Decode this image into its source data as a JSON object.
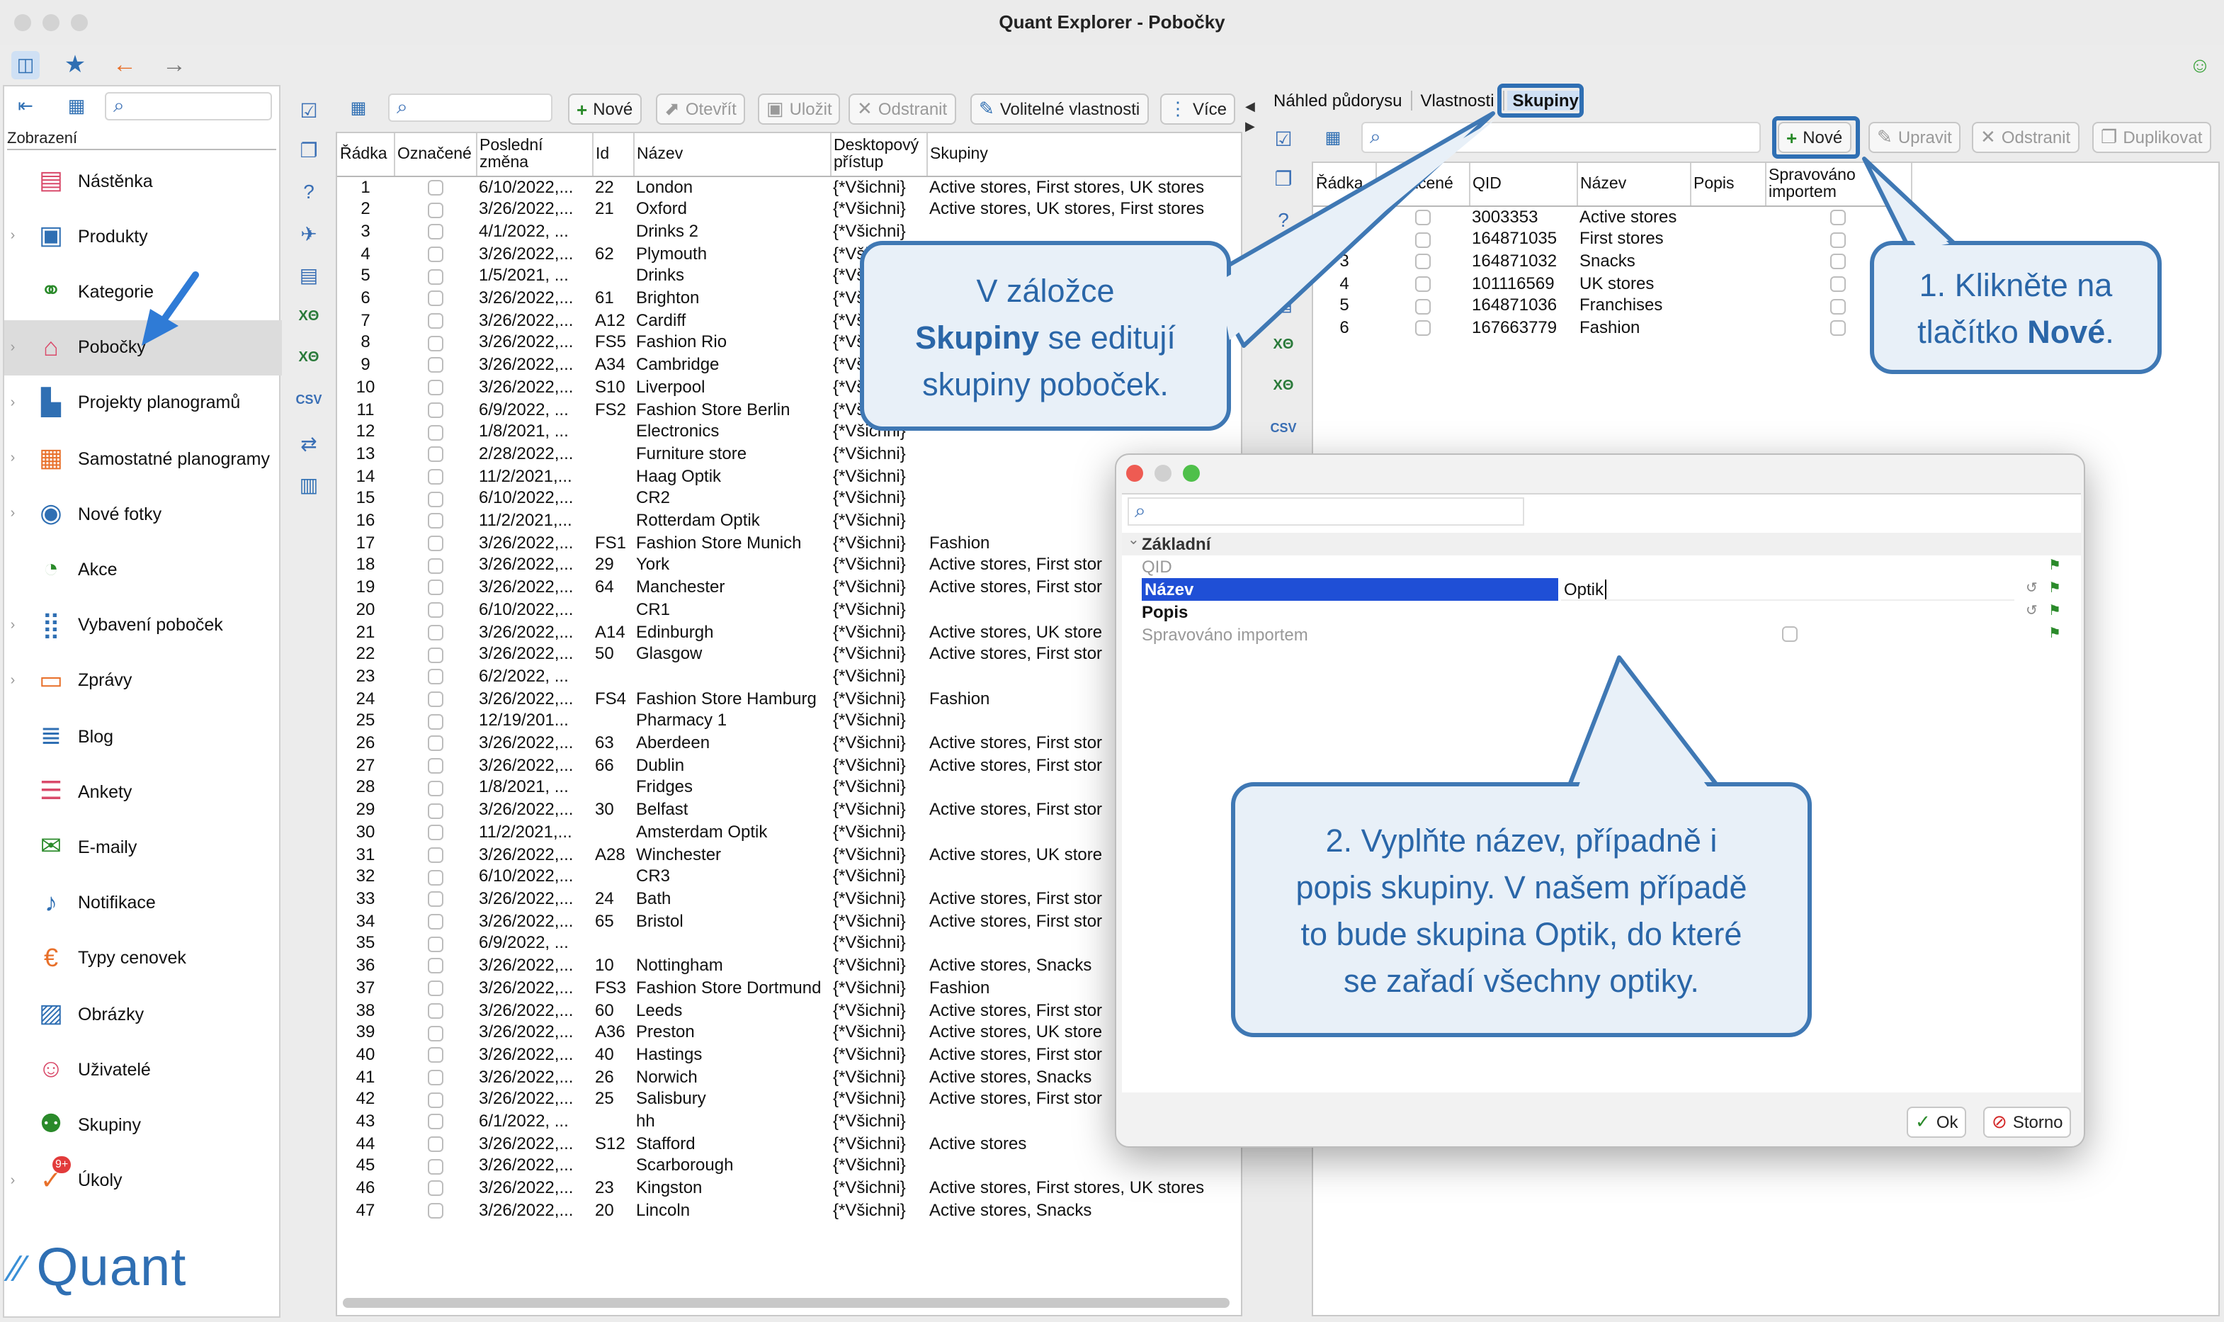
{
  "window": {
    "title": "Quant Explorer - Pobočky"
  },
  "sidebar": {
    "header": "Zobrazení",
    "items": [
      {
        "label": "Nástěnka",
        "icon": "dashboard-icon"
      },
      {
        "label": "Produkty",
        "icon": "product-icon"
      },
      {
        "label": "Kategorie",
        "icon": "category-icon"
      },
      {
        "label": "Pobočky",
        "icon": "store-icon",
        "selected": true
      },
      {
        "label": "Projekty planogramů",
        "icon": "planogram-project-icon"
      },
      {
        "label": "Samostatné planogramy",
        "icon": "planogram-icon"
      },
      {
        "label": "Nové fotky",
        "icon": "camera-icon"
      },
      {
        "label": "Akce",
        "icon": "promo-icon"
      },
      {
        "label": "Vybavení poboček",
        "icon": "equipment-icon"
      },
      {
        "label": "Zprávy",
        "icon": "message-icon"
      },
      {
        "label": "Blog",
        "icon": "blog-icon"
      },
      {
        "label": "Ankety",
        "icon": "survey-icon"
      },
      {
        "label": "E-maily",
        "icon": "email-icon"
      },
      {
        "label": "Notifikace",
        "icon": "bell-icon"
      },
      {
        "label": "Typy cenovek",
        "icon": "price-tag-icon"
      },
      {
        "label": "Obrázky",
        "icon": "image-icon"
      },
      {
        "label": "Uživatelé",
        "icon": "user-icon"
      },
      {
        "label": "Skupiny",
        "icon": "group-icon"
      },
      {
        "label": "Úkoly",
        "icon": "task-icon",
        "badge": "9+"
      }
    ],
    "logo": "Quant"
  },
  "stores": {
    "toolbar": {
      "new": "Nové",
      "open": "Otevřít",
      "save": "Uložit",
      "remove": "Odstranit",
      "props": "Volitelné vlastnosti",
      "more": "Více"
    },
    "columns": [
      "Řádka",
      "Označené",
      "Poslední změna",
      "Id",
      "Název",
      "Desktopový přístup",
      "Skupiny"
    ],
    "rows": [
      [
        "1",
        "6/10/2022,...",
        "22",
        "London",
        "{*Všichni}",
        "Active stores, First stores, UK stores"
      ],
      [
        "2",
        "3/26/2022,...",
        "21",
        "Oxford",
        "{*Všichni}",
        "Active stores, UK stores, First stores"
      ],
      [
        "3",
        "4/1/2022, ...",
        "",
        "Drinks 2",
        "{*Všichni}",
        ""
      ],
      [
        "4",
        "3/26/2022,...",
        "62",
        "Plymouth",
        "{*Všichni}",
        ""
      ],
      [
        "5",
        "1/5/2021, ...",
        "",
        "Drinks",
        "{*Všichni}",
        ""
      ],
      [
        "6",
        "3/26/2022,...",
        "61",
        "Brighton",
        "{*Všichni}",
        ""
      ],
      [
        "7",
        "3/26/2022,...",
        "A12",
        "Cardiff",
        "{*Všichni}",
        ""
      ],
      [
        "8",
        "3/26/2022,...",
        "FS5",
        "Fashion Rio",
        "{*Všichni}",
        ""
      ],
      [
        "9",
        "3/26/2022,...",
        "A34",
        "Cambridge",
        "{*Všichni}",
        ""
      ],
      [
        "10",
        "3/26/2022,...",
        "S10",
        "Liverpool",
        "{*Všichni}",
        ""
      ],
      [
        "11",
        "6/9/2022, ...",
        "FS2",
        "Fashion Store Berlin",
        "{*Všichni}",
        ""
      ],
      [
        "12",
        "1/8/2021, ...",
        "",
        "Electronics",
        "{*Všichni}",
        ""
      ],
      [
        "13",
        "2/28/2022,...",
        "",
        "Furniture store",
        "{*Všichni}",
        ""
      ],
      [
        "14",
        "11/2/2021,...",
        "",
        "Haag Optik",
        "{*Všichni}",
        ""
      ],
      [
        "15",
        "6/10/2022,...",
        "",
        "CR2",
        "{*Všichni}",
        ""
      ],
      [
        "16",
        "11/2/2021,...",
        "",
        "Rotterdam Optik",
        "{*Všichni}",
        ""
      ],
      [
        "17",
        "3/26/2022,...",
        "FS1",
        "Fashion Store Munich",
        "{*Všichni}",
        "Fashion"
      ],
      [
        "18",
        "3/26/2022,...",
        "29",
        "York",
        "{*Všichni}",
        "Active stores, First stor"
      ],
      [
        "19",
        "3/26/2022,...",
        "64",
        "Manchester",
        "{*Všichni}",
        "Active stores, First stor"
      ],
      [
        "20",
        "6/10/2022,...",
        "",
        "CR1",
        "{*Všichni}",
        ""
      ],
      [
        "21",
        "3/26/2022,...",
        "A14",
        "Edinburgh",
        "{*Všichni}",
        "Active stores, UK store"
      ],
      [
        "22",
        "3/26/2022,...",
        "50",
        "Glasgow",
        "{*Všichni}",
        "Active stores, First stor"
      ],
      [
        "23",
        "6/2/2022, ...",
        "",
        "",
        "{*Všichni}",
        ""
      ],
      [
        "24",
        "3/26/2022,...",
        "FS4",
        "Fashion Store Hamburg",
        "{*Všichni}",
        "Fashion"
      ],
      [
        "25",
        "12/19/201...",
        "",
        "Pharmacy 1",
        "{*Všichni}",
        ""
      ],
      [
        "26",
        "3/26/2022,...",
        "63",
        "Aberdeen",
        "{*Všichni}",
        "Active stores, First stor"
      ],
      [
        "27",
        "3/26/2022,...",
        "66",
        "Dublin",
        "{*Všichni}",
        "Active stores, First stor"
      ],
      [
        "28",
        "1/8/2021, ...",
        "",
        "Fridges",
        "{*Všichni}",
        ""
      ],
      [
        "29",
        "3/26/2022,...",
        "30",
        "Belfast",
        "{*Všichni}",
        "Active stores, First stor"
      ],
      [
        "30",
        "11/2/2021,...",
        "",
        "Amsterdam Optik",
        "{*Všichni}",
        ""
      ],
      [
        "31",
        "3/26/2022,...",
        "A28",
        "Winchester",
        "{*Všichni}",
        "Active stores, UK store"
      ],
      [
        "32",
        "6/10/2022,...",
        "",
        "CR3",
        "{*Všichni}",
        ""
      ],
      [
        "33",
        "3/26/2022,...",
        "24",
        "Bath",
        "{*Všichni}",
        "Active stores, First stor"
      ],
      [
        "34",
        "3/26/2022,...",
        "65",
        "Bristol",
        "{*Všichni}",
        "Active stores, First stor"
      ],
      [
        "35",
        "6/9/2022, ...",
        "",
        "",
        "{*Všichni}",
        ""
      ],
      [
        "36",
        "3/26/2022,...",
        "10",
        "Nottingham",
        "{*Všichni}",
        "Active stores, Snacks"
      ],
      [
        "37",
        "3/26/2022,...",
        "FS3",
        "Fashion Store Dortmund",
        "{*Všichni}",
        "Fashion"
      ],
      [
        "38",
        "3/26/2022,...",
        "60",
        "Leeds",
        "{*Všichni}",
        "Active stores, First stor"
      ],
      [
        "39",
        "3/26/2022,...",
        "A36",
        "Preston",
        "{*Všichni}",
        "Active stores, UK store"
      ],
      [
        "40",
        "3/26/2022,...",
        "40",
        "Hastings",
        "{*Všichni}",
        "Active stores, First stor"
      ],
      [
        "41",
        "3/26/2022,...",
        "26",
        "Norwich",
        "{*Všichni}",
        "Active stores, Snacks"
      ],
      [
        "42",
        "3/26/2022,...",
        "25",
        "Salisbury",
        "{*Všichni}",
        "Active stores, First stor"
      ],
      [
        "43",
        "6/1/2022, ...",
        "",
        "hh",
        "{*Všichni}",
        ""
      ],
      [
        "44",
        "3/26/2022,...",
        "S12",
        "Stafford",
        "{*Všichni}",
        "Active stores"
      ],
      [
        "45",
        "3/26/2022,...",
        "",
        "Scarborough",
        "{*Všichni}",
        ""
      ],
      [
        "46",
        "3/26/2022,...",
        "23",
        "Kingston",
        "{*Všichni}",
        "Active stores, First stores, UK stores"
      ],
      [
        "47",
        "3/26/2022,...",
        "20",
        "Lincoln",
        "{*Všichni}",
        "Active stores, Snacks"
      ]
    ]
  },
  "detail": {
    "tabs": [
      "Náhled půdorysu",
      "Vlastnosti",
      "Skupiny"
    ],
    "toolbar": {
      "new": "Nové",
      "edit": "Upravit",
      "remove": "Odstranit",
      "duplicate": "Duplikovat"
    },
    "columns": [
      "Řádka",
      "Označené",
      "QID",
      "Název",
      "Popis",
      "Spravováno importem"
    ],
    "rows": [
      [
        "1",
        "3003353",
        "Active stores"
      ],
      [
        "2",
        "164871035",
        "First stores"
      ],
      [
        "3",
        "164871032",
        "Snacks"
      ],
      [
        "4",
        "101116569",
        "UK stores"
      ],
      [
        "5",
        "164871036",
        "Franchises"
      ],
      [
        "6",
        "167663779",
        "Fashion"
      ]
    ]
  },
  "dialog": {
    "section": "Základní",
    "props": [
      {
        "label": "QID",
        "value": ""
      },
      {
        "label": "Název",
        "value": "Optik"
      },
      {
        "label": "Popis",
        "value": ""
      },
      {
        "label": "Spravováno importem",
        "value": ""
      }
    ],
    "ok": "Ok",
    "cancel": "Storno"
  },
  "callouts": {
    "a": [
      "V záložce",
      "Skupiny",
      " se editují",
      "skupiny poboček."
    ],
    "b": [
      "1. Klikněte na",
      "tlačítko ",
      "Nové",
      "."
    ],
    "c": [
      "2. Vyplňte název, případně i",
      "popis skupiny. V našem případě",
      "to bude skupina Optik, do které",
      "se zařadí všechny optiky."
    ]
  },
  "colors": {
    "accent": "#3f78b4",
    "selection": "#1f4fd6",
    "callout_bg": "#e8f0f8"
  }
}
